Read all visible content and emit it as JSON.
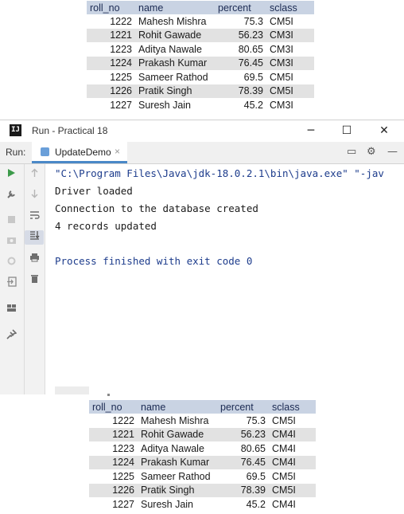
{
  "top_table": {
    "headers": [
      "roll_no",
      "name",
      "percent",
      "sclass"
    ],
    "rows": [
      [
        "1222",
        "Mahesh Mishra",
        "75.3",
        "CM5I"
      ],
      [
        "1221",
        "Rohit Gawade",
        "56.23",
        "CM3I"
      ],
      [
        "1223",
        "Aditya Nawale",
        "80.65",
        "CM3I"
      ],
      [
        "1224",
        "Prakash Kumar",
        "76.45",
        "CM3I"
      ],
      [
        "1225",
        "Sameer Rathod",
        "69.5",
        "CM5I"
      ],
      [
        "1226",
        "Pratik Singh",
        "78.39",
        "CM5I"
      ],
      [
        "1227",
        "Suresh Jain",
        "45.2",
        "CM3I"
      ]
    ]
  },
  "ide": {
    "logo_text": "IJ",
    "window_title": "Run - Practical 18",
    "run_label": "Run:",
    "tab_label": "UpdateDemo",
    "console_lines": {
      "cmd": "\"C:\\Program Files\\Java\\jdk-18.0.2.1\\bin\\java.exe\" \"-jav",
      "l1": "Driver loaded",
      "l2": "Connection to the database created",
      "l3": "4 records updated",
      "exit": "Process finished with exit code 0"
    },
    "icons": {
      "minimize": "─",
      "maximize": "☐",
      "close": "✕",
      "tab_close": "×",
      "layout": "▭",
      "settings": "⚙",
      "hide": "—"
    }
  },
  "bottom_table": {
    "headers": [
      "roll_no",
      "name",
      "percent",
      "sclass"
    ],
    "rows": [
      [
        "1222",
        "Mahesh Mishra",
        "75.3",
        "CM5I"
      ],
      [
        "1221",
        "Rohit Gawade",
        "56.23",
        "CM4I"
      ],
      [
        "1223",
        "Aditya Nawale",
        "80.65",
        "CM4I"
      ],
      [
        "1224",
        "Prakash Kumar",
        "76.45",
        "CM4I"
      ],
      [
        "1225",
        "Sameer Rathod",
        "69.5",
        "CM5I"
      ],
      [
        "1226",
        "Pratik Singh",
        "78.39",
        "CM5I"
      ],
      [
        "1227",
        "Suresh Jain",
        "45.2",
        "CM4I"
      ]
    ]
  }
}
